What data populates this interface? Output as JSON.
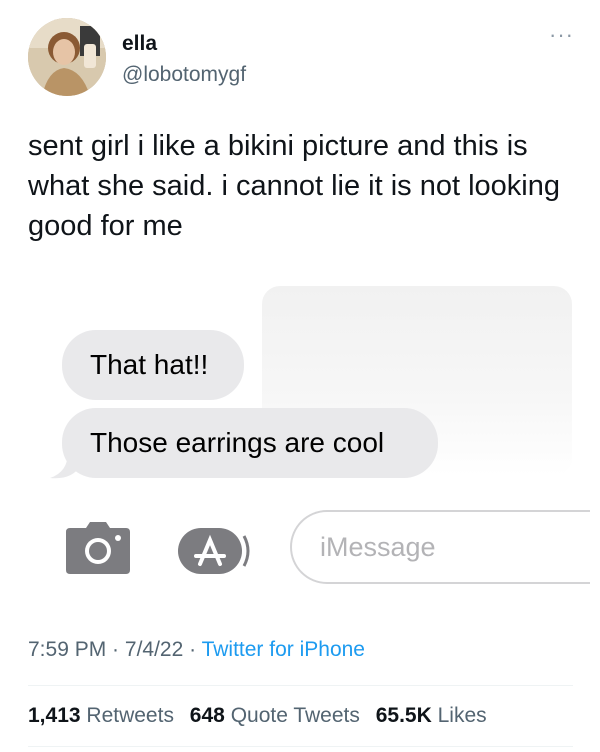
{
  "author": {
    "name": "ella",
    "handle": "@lobotomygf",
    "more_icon": "more-horizontal-icon"
  },
  "tweet": {
    "text": "sent girl i like a bikini picture and this is what she said. i cannot lie it is not looking good for me",
    "time": "7:59 PM",
    "separator": " · ",
    "date": "7/4/22",
    "source": "Twitter for iPhone"
  },
  "screenshot": {
    "messages": [
      "That hat!!",
      "Those earrings are cool"
    ],
    "input_placeholder": "iMessage",
    "icons": [
      "camera-icon",
      "app-store-icon"
    ]
  },
  "stats": {
    "retweets_count": "1,413",
    "retweets_label": "Retweets",
    "quotes_count": "648",
    "quotes_label": "Quote Tweets",
    "likes_count": "65.5K",
    "likes_label": "Likes"
  },
  "colors": {
    "text": "#0f1419",
    "secondary": "#536471",
    "link": "#1d9bf0",
    "bubble": "#e9e9eb"
  }
}
